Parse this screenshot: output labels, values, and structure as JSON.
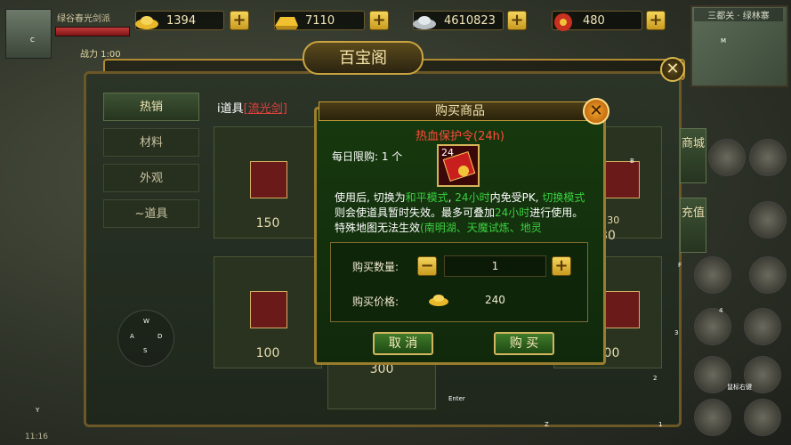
{
  "resources": [
    {
      "icon": "gold-ingot-icon",
      "value": "1394"
    },
    {
      "icon": "gold-bar-icon",
      "value": "7110"
    },
    {
      "icon": "silver-ingot-icon",
      "value": "4610823"
    },
    {
      "icon": "red-pouch-icon",
      "value": "480"
    }
  ],
  "resource_plus": "+",
  "player": {
    "name": "绿谷春光剑派",
    "power": "战力 1:00"
  },
  "minimap": {
    "name": "三都关 · 绿林寨"
  },
  "panel": {
    "title": "百宝阁",
    "close": "✕"
  },
  "categories": [
    "热销",
    "材料",
    "外观",
    "~道具"
  ],
  "breadcrumb": {
    "prefix": "i道具",
    "link": "[流光剑]"
  },
  "right_tabs": [
    "商城",
    "充值"
  ],
  "cards": [
    {
      "name": "",
      "price": "150"
    },
    {
      "name": "",
      "price": "100"
    },
    {
      "name": "",
      "price": "300"
    },
    {
      "name": "",
      "price": "200"
    },
    {
      "name": "",
      "price": "30"
    },
    {
      "name": "限购: 30",
      "price": ""
    }
  ],
  "modal": {
    "title": "购买商品",
    "close": "✕",
    "item_name": "热血保护令(24h)",
    "limit": "每日限购: 1 个",
    "icon_count": "24",
    "desc_parts": [
      {
        "text": "使用后, 切换为",
        "green": false
      },
      {
        "text": "和平模式",
        "green": true
      },
      {
        "text": ", ",
        "green": false
      },
      {
        "text": "24小时",
        "green": true
      },
      {
        "text": "内免受PK, ",
        "green": false
      },
      {
        "text": "切换模式",
        "green": true
      },
      {
        "text": "则会使道具暂时失效。最多可叠加",
        "green": false
      },
      {
        "text": "24小时",
        "green": true
      },
      {
        "text": "进行使用。特殊地图无法生效",
        "green": false
      },
      {
        "text": "(南明湖、天魔试炼、地灵",
        "green": true
      }
    ],
    "qty_label": "购买数量:",
    "qty_value": "1",
    "minus": "−",
    "plus": "+",
    "price_label": "购买价格:",
    "price_value": "240",
    "cancel": "取 消",
    "buy": "购 买"
  },
  "hints": {
    "c": "C",
    "m": "M",
    "b": "B",
    "f": "F",
    "four": "4",
    "three": "3",
    "two": "2",
    "one": "1",
    "w": "W",
    "a": "A",
    "d": "D",
    "s": "S",
    "y": "Y",
    "z": "Z",
    "enter": "Enter",
    "right_click": "鼠标右键",
    "time": "11:16"
  }
}
